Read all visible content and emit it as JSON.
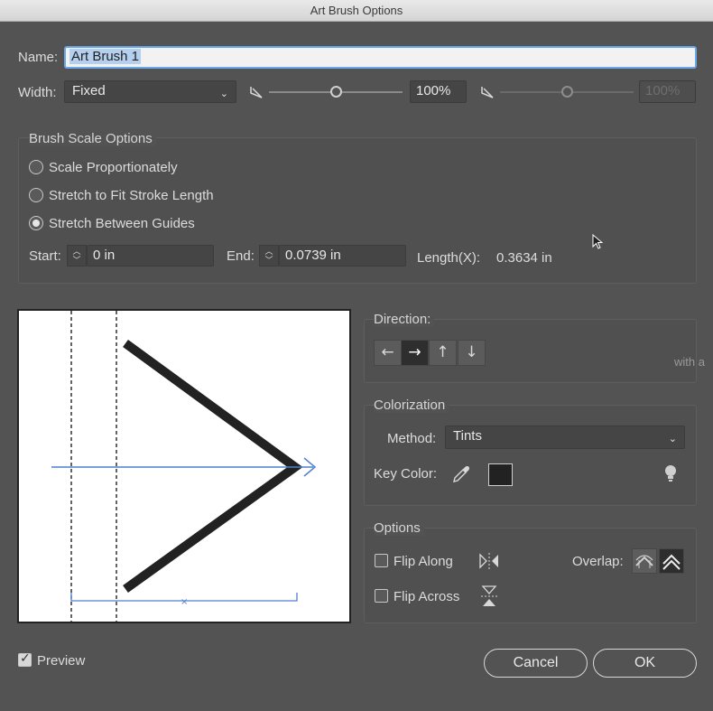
{
  "window": {
    "title": "Art Brush Options"
  },
  "name": {
    "label": "Name:",
    "value": "Art Brush 1"
  },
  "width": {
    "label": "Width:",
    "method": "Fixed",
    "value": "100%",
    "value2": "100%",
    "slider_fraction": 0.5,
    "slider2_fraction": 0.5
  },
  "scale": {
    "title": "Brush Scale Options",
    "options": [
      "Scale Proportionately",
      "Stretch to Fit Stroke Length",
      "Stretch Between Guides"
    ],
    "selected_index": 2,
    "start_label": "Start:",
    "start_value": "0 in",
    "end_label": "End:",
    "end_value": "0.0739 in",
    "length_label": "Length(X):",
    "length_value": "0.3634 in"
  },
  "direction": {
    "title": "Direction:",
    "buttons": [
      "←",
      "→",
      "↑",
      "↓"
    ],
    "selected_index": 1
  },
  "colorization": {
    "title": "Colorization",
    "method_label": "Method:",
    "method_value": "Tints",
    "key_label": "Key Color:",
    "key_color": "#222222"
  },
  "options": {
    "title": "Options",
    "flip_along": "Flip Along",
    "flip_across": "Flip Across",
    "overlap_label": "Overlap:"
  },
  "preview": {
    "label": "Preview",
    "checked": true
  },
  "buttons": {
    "cancel": "Cancel",
    "ok": "OK"
  },
  "stray_text": "with a"
}
